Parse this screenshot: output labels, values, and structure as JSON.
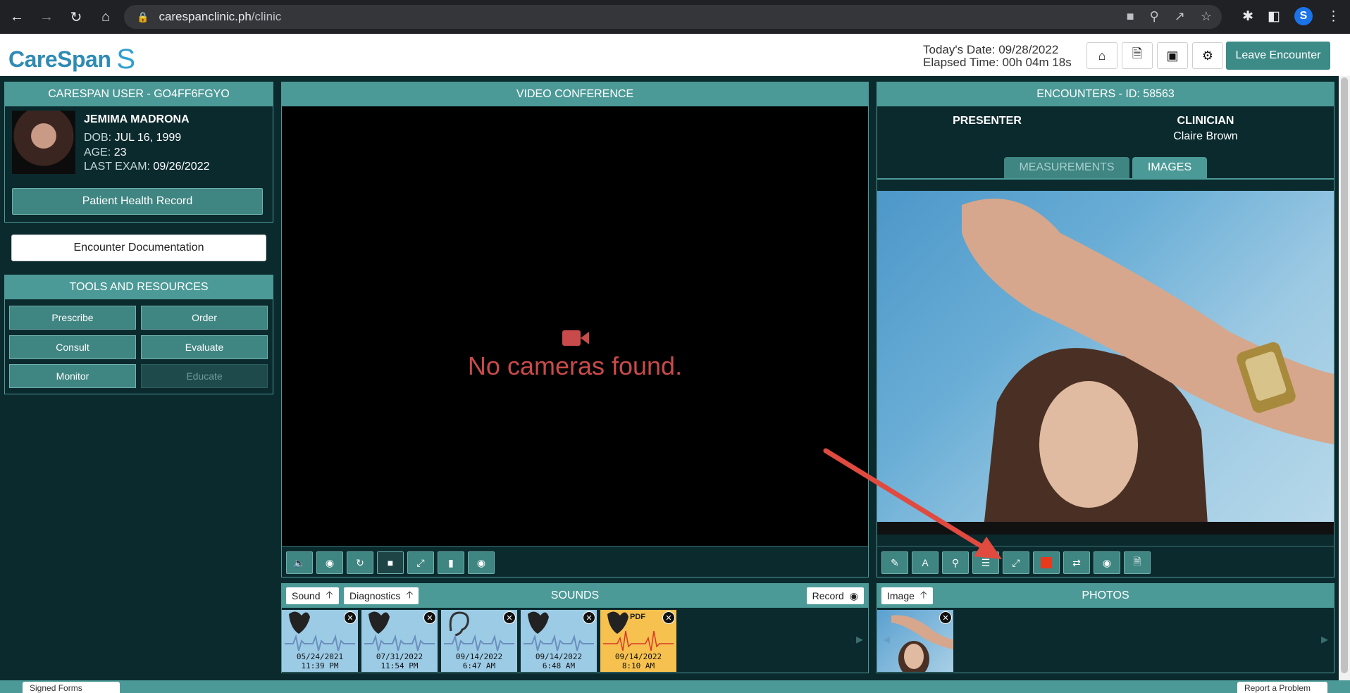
{
  "browser": {
    "url_host": "carespanclinic.ph",
    "url_path": "/clinic",
    "profile_initial": "S"
  },
  "header": {
    "logo_text": "CareSpan",
    "logo_mark": "S",
    "today_label": "Today's Date: 09/28/2022",
    "elapsed_label": "Elapsed Time: 00h 04m 18s",
    "leave_button": "Leave Encounter"
  },
  "user_panel": {
    "title": "CARESPAN USER - GO4FF6FGYO",
    "patient_name": "JEMIMA MADRONA",
    "dob_label": "DOB:",
    "dob_value": "JUL 16, 1999",
    "age_label": "AGE:",
    "age_value": "23",
    "last_exam_label": "LAST EXAM:",
    "last_exam_value": "09/26/2022",
    "phr_button": "Patient Health Record"
  },
  "encounter_doc_button": "Encounter Documentation",
  "tools": {
    "title": "TOOLS AND RESOURCES",
    "buttons": [
      "Prescribe",
      "Order",
      "Consult",
      "Evaluate",
      "Monitor",
      "Educate"
    ]
  },
  "video": {
    "title": "VIDEO CONFERENCE",
    "message": "No cameras found."
  },
  "encounter": {
    "title": "ENCOUNTERS - ID: 58563",
    "presenter_label": "PRESENTER",
    "clinician_label": "CLINICIAN",
    "clinician_name": "Claire Brown",
    "tabs": [
      "MEASUREMENTS",
      "IMAGES"
    ],
    "active_tab": "IMAGES"
  },
  "sounds": {
    "title": "SOUNDS",
    "sound_chip": "Sound",
    "diagnostics_chip": "Diagnostics",
    "record_chip": "Record",
    "items": [
      {
        "date": "05/24/2021",
        "time": "11:39 PM",
        "kind": "heart"
      },
      {
        "date": "07/31/2022",
        "time": "11:54 PM",
        "kind": "heart"
      },
      {
        "date": "09/14/2022",
        "time": "6:47 AM",
        "kind": "ear"
      },
      {
        "date": "09/14/2022",
        "time": "6:48 AM",
        "kind": "heart"
      },
      {
        "date": "09/14/2022",
        "time": "8:10 AM",
        "kind": "pdf",
        "label": "PDF"
      }
    ]
  },
  "photos": {
    "title": "PHOTOS",
    "image_chip": "Image"
  },
  "footer": {
    "left_tab": "Signed Forms",
    "right_tab": "Report a Problem"
  },
  "colors": {
    "teal": "#4c9a97",
    "dark_bg": "#0b2a2e",
    "alert_red": "#c94a4a",
    "annotation_arrow": "#e04a3f"
  }
}
